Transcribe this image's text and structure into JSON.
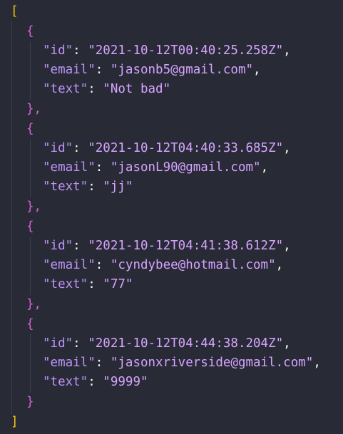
{
  "editor": {
    "open_bracket": "[",
    "close_bracket": "]",
    "open_brace": "{",
    "close_brace_comma": "},",
    "close_brace": "}",
    "colors": {
      "background": "#282a36",
      "outer_bracket": "#f1c40f",
      "brace": "#d163d4",
      "key": "#bd93f9",
      "string": "#d6a4ff"
    },
    "records": [
      {
        "id_key": "\"id\"",
        "id_value": "\"2021-10-12T00:40:25.258Z\"",
        "email_key": "\"email\"",
        "email_value": "\"jasonb5@gmail.com\"",
        "text_key": "\"text\"",
        "text_value": "\"Not bad\""
      },
      {
        "id_key": "\"id\"",
        "id_value": "\"2021-10-12T04:40:33.685Z\"",
        "email_key": "\"email\"",
        "email_value": "\"jasonL90@gmail.com\"",
        "text_key": "\"text\"",
        "text_value": "\"jj\""
      },
      {
        "id_key": "\"id\"",
        "id_value": "\"2021-10-12T04:41:38.612Z\"",
        "email_key": "\"email\"",
        "email_value": "\"cyndybee@hotmail.com\"",
        "text_key": "\"text\"",
        "text_value": "\"77\""
      },
      {
        "id_key": "\"id\"",
        "id_value": "\"2021-10-12T04:44:38.204Z\"",
        "email_key": "\"email\"",
        "email_value": "\"jasonxriverside@gmail.com\"",
        "text_key": "\"text\"",
        "text_value": "\"9999\""
      }
    ]
  }
}
